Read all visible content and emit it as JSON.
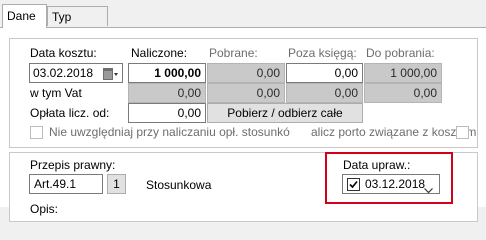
{
  "tabs": [
    {
      "label": "Dane",
      "active": true
    },
    {
      "label": "Typ opłaty",
      "active": false
    }
  ],
  "columns": {
    "data_kosztu": "Data kosztu:",
    "naliczone": "Naliczone:",
    "pobrane": "Pobrane:",
    "poza_ksiega": "Poza księgą:",
    "do_pobrania": "Do pobrania:"
  },
  "row_main": {
    "date": "03.02.2018",
    "naliczone": "1 000,00",
    "pobrane": "0,00",
    "poza_ksiega": "0,00",
    "do_pobrania": "1 000,00"
  },
  "row_vat": {
    "label": "w tym Vat",
    "naliczone": "0,00",
    "pobrane": "0,00",
    "poza_ksiega": "0,00",
    "do_pobrania": "0,00"
  },
  "row_oplata": {
    "label": "Opłata licz. od:",
    "value": "0,00",
    "button": "Pobierz / odbierz całe"
  },
  "checkbox_left": {
    "label": "Nie uwzględniaj przy naliczaniu opł. stosunkó",
    "checked": false
  },
  "checkbox_right": {
    "label": "alicz porto związane z kosztem",
    "checked": false
  },
  "przepis": {
    "label": "Przepis prawny:",
    "value": "Art.49.1",
    "button": "1",
    "type_text": "Stosunkowa"
  },
  "data_upraw": {
    "label": "Data upraw.:",
    "value": "03.12.2018",
    "checked": true
  },
  "opis": {
    "label": "Opis:"
  },
  "colors": {
    "highlight": "#d0021b",
    "readonly_bg": "#c9c9c9"
  }
}
